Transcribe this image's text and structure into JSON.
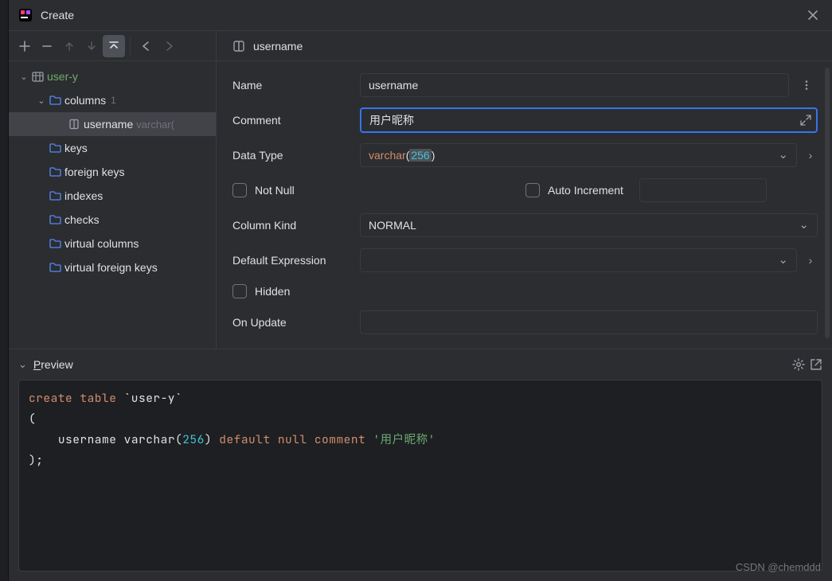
{
  "window": {
    "title": "Create"
  },
  "tree": {
    "root": "user-y",
    "columns_label": "columns",
    "columns_count": "1",
    "column_item": "username",
    "column_item_type": "varchar(",
    "items": [
      "keys",
      "foreign keys",
      "indexes",
      "checks",
      "virtual columns",
      "virtual foreign keys"
    ]
  },
  "column": {
    "header": "username",
    "name_label": "Name",
    "name_value": "username",
    "comment_label": "Comment",
    "comment_value": "用户昵称",
    "datatype_label": "Data Type",
    "datatype_prefix": "varchar",
    "datatype_size": "256",
    "notnull_label": "Not Null",
    "autoincrement_label": "Auto Increment",
    "kind_label": "Column Kind",
    "kind_value": "NORMAL",
    "default_label": "Default Expression",
    "hidden_label": "Hidden",
    "onupdate_label": "On Update"
  },
  "preview": {
    "title": "Preview",
    "sql_kw1": "create table",
    "sql_ident1": "`user-y`",
    "sql_open": "(",
    "sql_col": "username",
    "sql_type": "varchar",
    "sql_len": "256",
    "sql_kw2": "default null comment",
    "sql_str": "'用户昵称'",
    "sql_close": ");"
  },
  "watermark": "CSDN @chemddd"
}
